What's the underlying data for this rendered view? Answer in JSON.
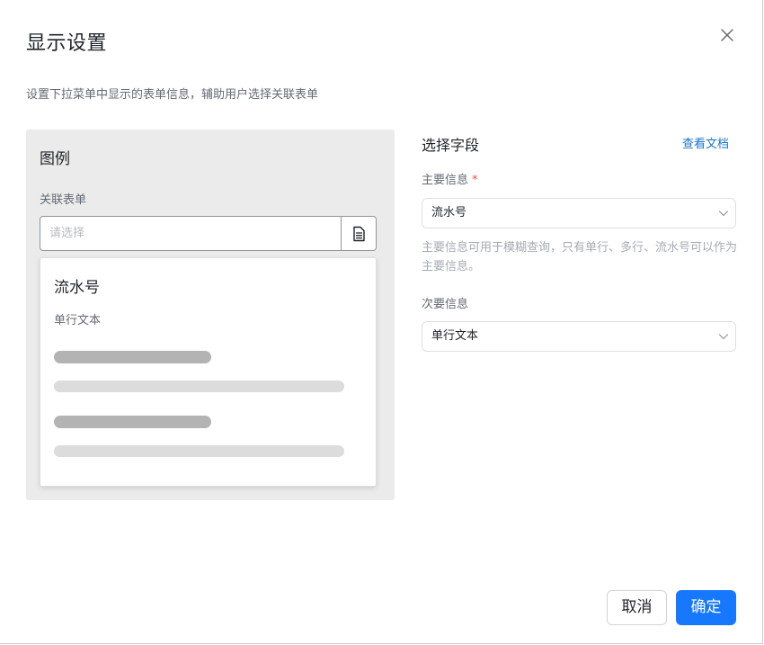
{
  "dialog": {
    "title": "显示设置",
    "subtitle": "设置下拉菜单中显示的表单信息，辅助用户选择关联表单"
  },
  "icons": {
    "close": "close-icon",
    "document": "document-icon",
    "chevron": "chevron-down-icon"
  },
  "preview": {
    "heading": "图例",
    "field_label": "关联表单",
    "placeholder": "请选择",
    "dropdown": {
      "primary": "流水号",
      "secondary": "单行文本"
    }
  },
  "settings": {
    "title": "选择字段",
    "doc_link": "查看文档",
    "primary": {
      "label": "主要信息",
      "required_mark": "*",
      "value": "流水号",
      "help": "主要信息可用于模糊查询，只有单行、多行、流水号可以作为主要信息。"
    },
    "secondary": {
      "label": "次要信息",
      "value": "单行文本"
    }
  },
  "footer": {
    "cancel_label": "取消",
    "ok_label": "确定"
  },
  "colors": {
    "accent": "#1677ff",
    "link": "#1a73c8",
    "required": "#f54a45"
  }
}
